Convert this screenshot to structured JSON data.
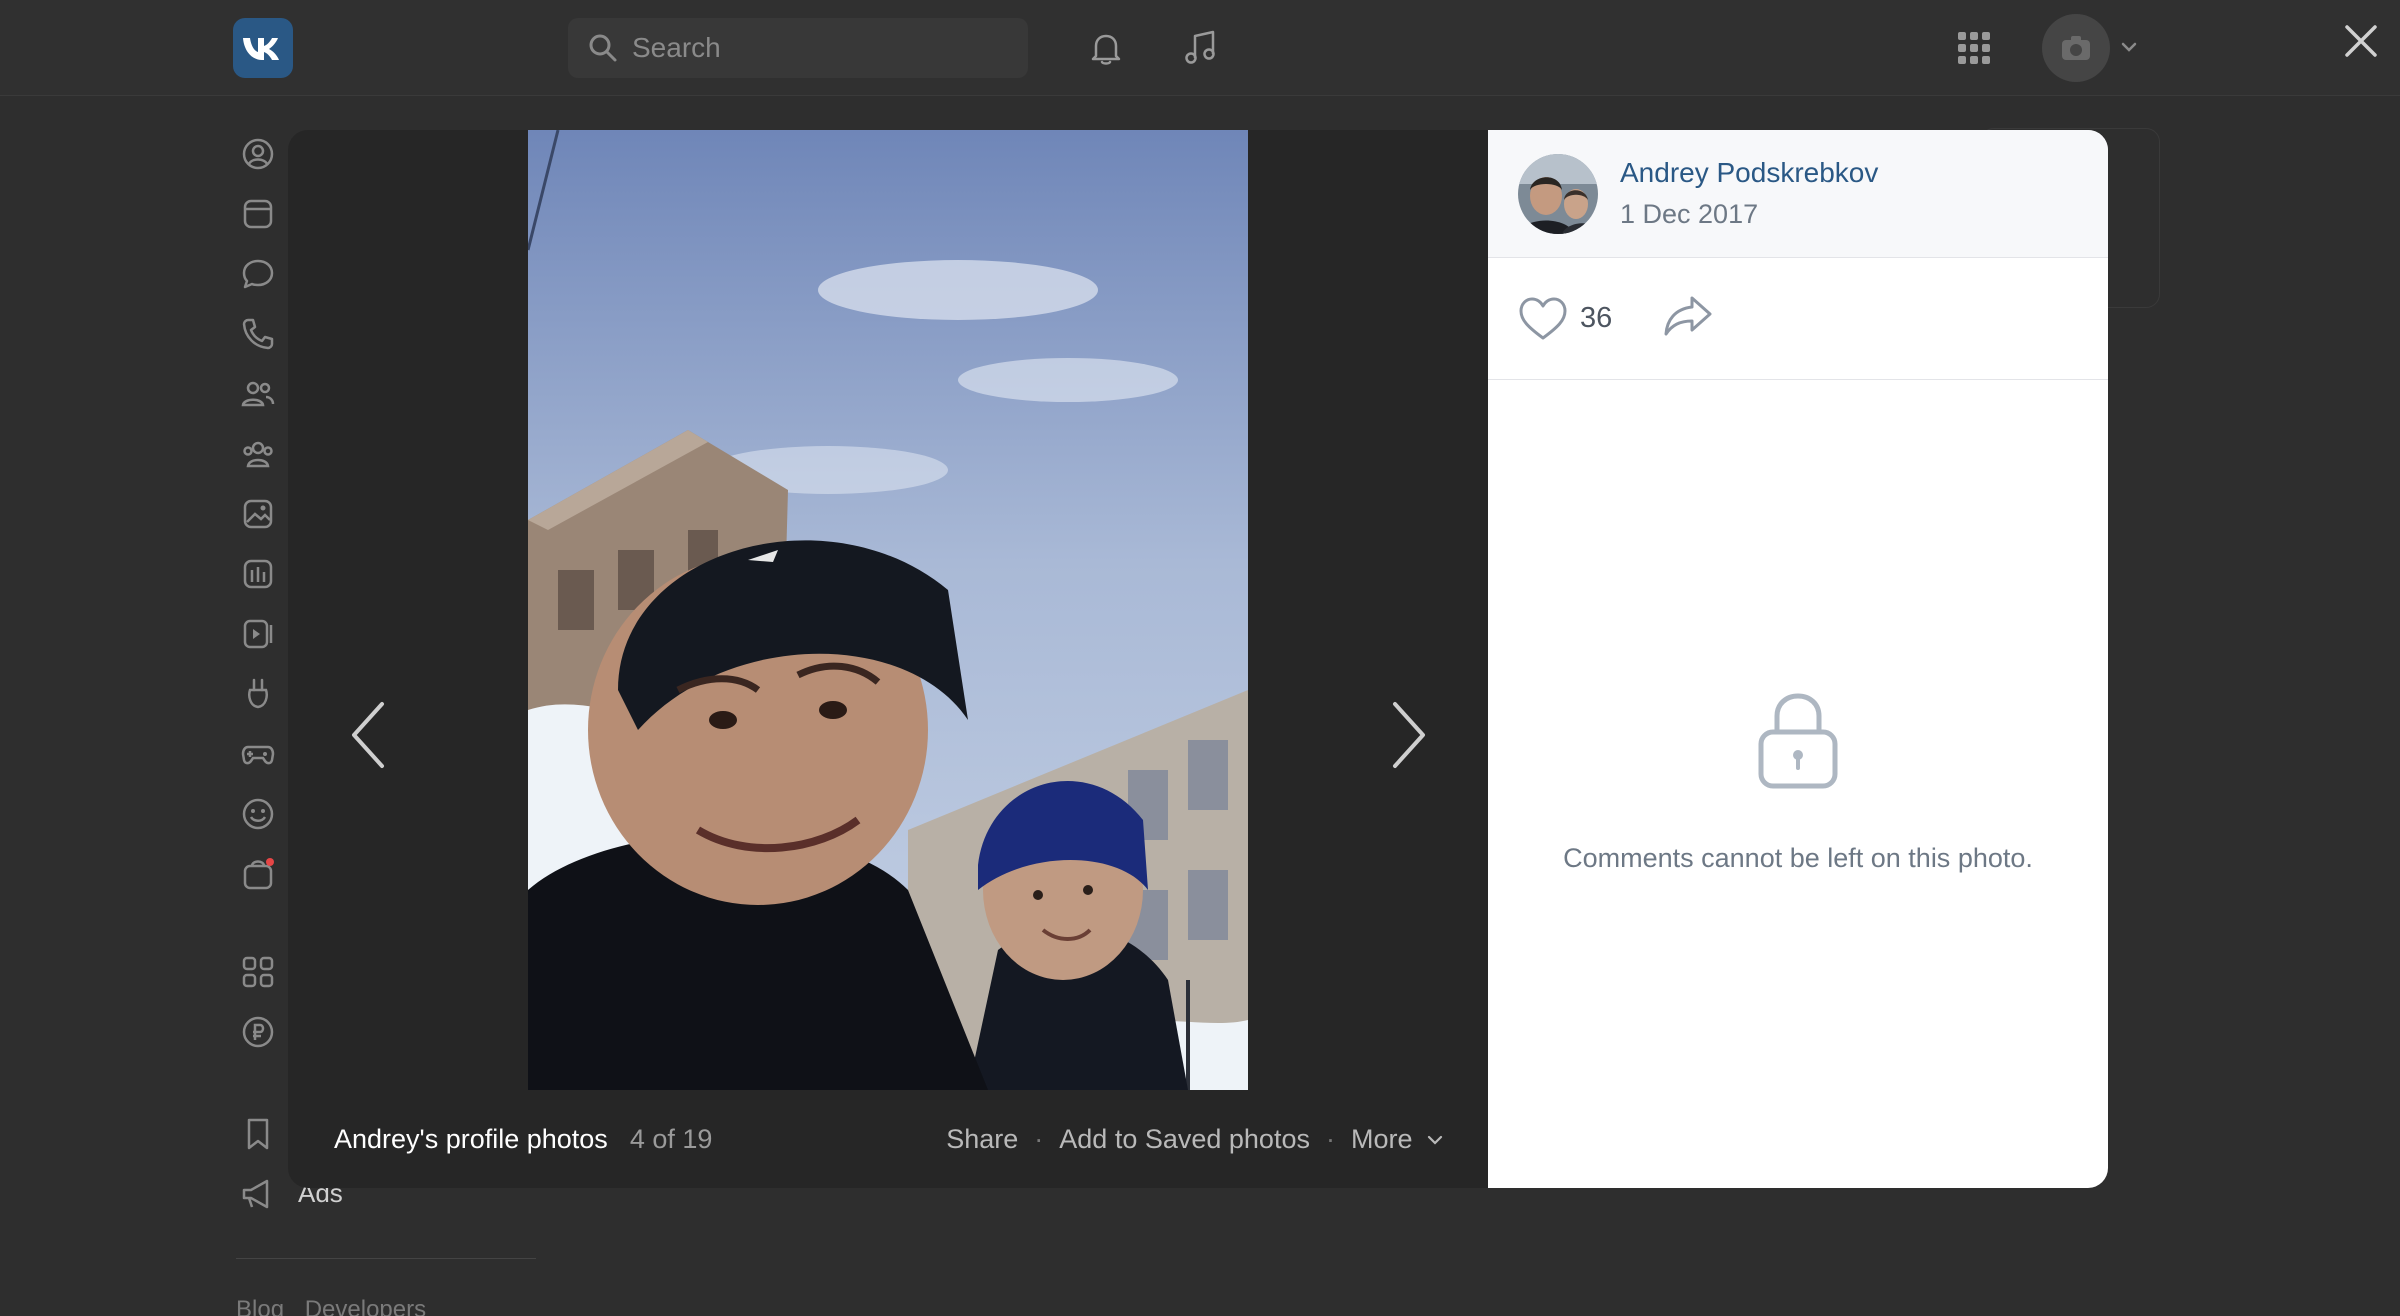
{
  "header": {
    "search_placeholder": "Search"
  },
  "sidebar": {
    "ads_label": "Ads",
    "footer_links": [
      "Blog",
      "Developers"
    ]
  },
  "viewer": {
    "album_title": "Andrey's profile photos",
    "photo_counter": "4 of 19",
    "actions": {
      "share": "Share",
      "add_saved": "Add to Saved photos",
      "more": "More"
    }
  },
  "info": {
    "author_name": "Andrey Podskrebkov",
    "date": "1 Dec 2017",
    "likes": "36",
    "comments_locked_text": "Comments cannot be left on this photo."
  },
  "colors": {
    "accent": "#2a5885",
    "background_dim": "#2e2e2e"
  }
}
